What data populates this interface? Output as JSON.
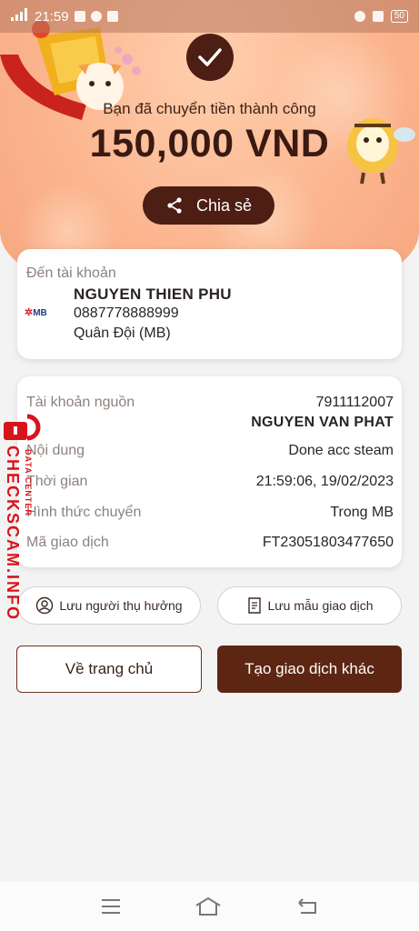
{
  "status_bar": {
    "time": "21:59",
    "battery": "50"
  },
  "header": {
    "success_text": "Bạn đã chuyển tiền thành công",
    "amount": "150,000 VND",
    "share_label": "Chia sẻ"
  },
  "recipient": {
    "label": "Đến tài khoản",
    "bank_logo": "MB",
    "name": "NGUYEN THIEN PHU",
    "account": "0887778888999",
    "bank": "Quân Đội (MB)"
  },
  "details": {
    "rows": [
      {
        "key": "Tài khoản nguồn",
        "value": "7911112007",
        "value2": "NGUYEN VAN PHAT"
      },
      {
        "key": "Nội dung",
        "value": "Done acc steam"
      },
      {
        "key": "Thời gian",
        "value": "21:59:06, 19/02/2023"
      },
      {
        "key": "Hình thức chuyển",
        "value": "Trong MB"
      },
      {
        "key": "Mã giao dịch",
        "value": "FT23051803477650"
      }
    ]
  },
  "actions": {
    "save_beneficiary": "Lưu người thụ hưởng",
    "save_template": "Lưu mẫu giao dịch",
    "home": "Về trang chủ",
    "new_transaction": "Tạo giao dịch khác"
  },
  "watermark": {
    "main": "CHECKSCAM.INFO",
    "sub": "DATA CENTER"
  },
  "colors": {
    "brand_dark": "#4c1e14",
    "button_primary": "#5d2613",
    "hero": "#fbb58f",
    "watermark": "#d7141a"
  },
  "icons": [
    "check-icon",
    "share-icon",
    "user-circle-icon",
    "receipt-icon",
    "menu-icon",
    "home-icon",
    "back-icon",
    "lock-icon"
  ]
}
